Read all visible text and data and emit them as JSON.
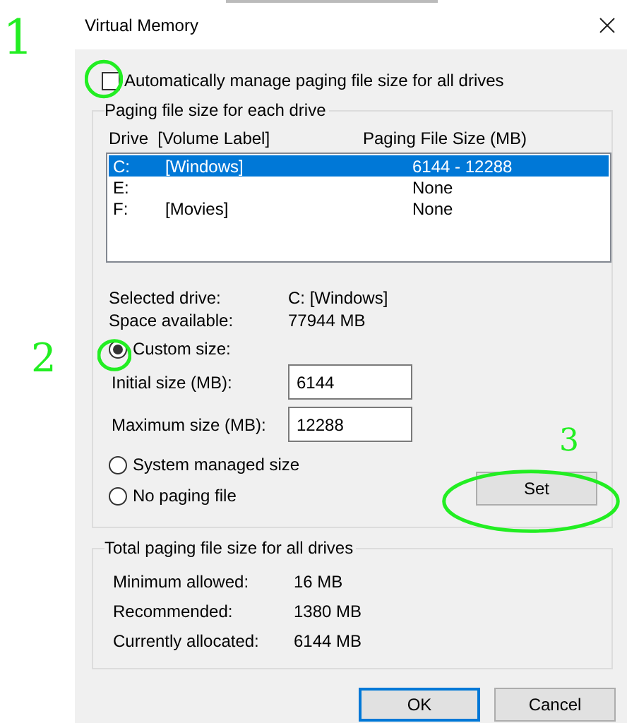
{
  "window": {
    "title": "Virtual Memory"
  },
  "auto_manage": {
    "label": "Automatically manage paging file size for all drives",
    "checked": false
  },
  "drive_group": {
    "title": "Paging file size for each drive",
    "columns": [
      "Drive  [Volume Label]",
      "Paging File Size (MB)"
    ],
    "rows": [
      {
        "drive": "C:",
        "label": "[Windows]",
        "size": "6144 - 12288",
        "selected": true
      },
      {
        "drive": "E:",
        "size": "None",
        "selected": false
      },
      {
        "drive": "F:",
        "label": "[Movies]",
        "size": "None",
        "selected": false
      }
    ]
  },
  "drive_info": [
    {
      "label": "Selected drive:",
      "value": "C:  [Windows]"
    },
    {
      "label": "Space available:",
      "value": "77944 MB"
    }
  ],
  "size_options": [
    {
      "label": "Custom size:",
      "selected": true
    },
    {
      "label": "System managed size",
      "selected": false
    },
    {
      "label": "No paging file",
      "selected": false
    }
  ],
  "fields": [
    {
      "label": "Initial size (MB):",
      "value": "6144"
    },
    {
      "label": "Maximum size (MB):",
      "value": "12288"
    }
  ],
  "set_button": {
    "label": "Set"
  },
  "totals": {
    "title": "Total paging file size for all drives",
    "rows": [
      {
        "label": "Minimum allowed:",
        "value": "16 MB"
      },
      {
        "label": "Recommended:",
        "value": "1380 MB"
      },
      {
        "label": "Currently allocated:",
        "value": "6144 MB"
      }
    ]
  },
  "buttons": [
    {
      "label": "OK",
      "default": true
    },
    {
      "label": "Cancel",
      "default": false
    }
  ],
  "annotations": [
    {
      "label": "1"
    },
    {
      "label": "2"
    },
    {
      "label": "3"
    }
  ]
}
